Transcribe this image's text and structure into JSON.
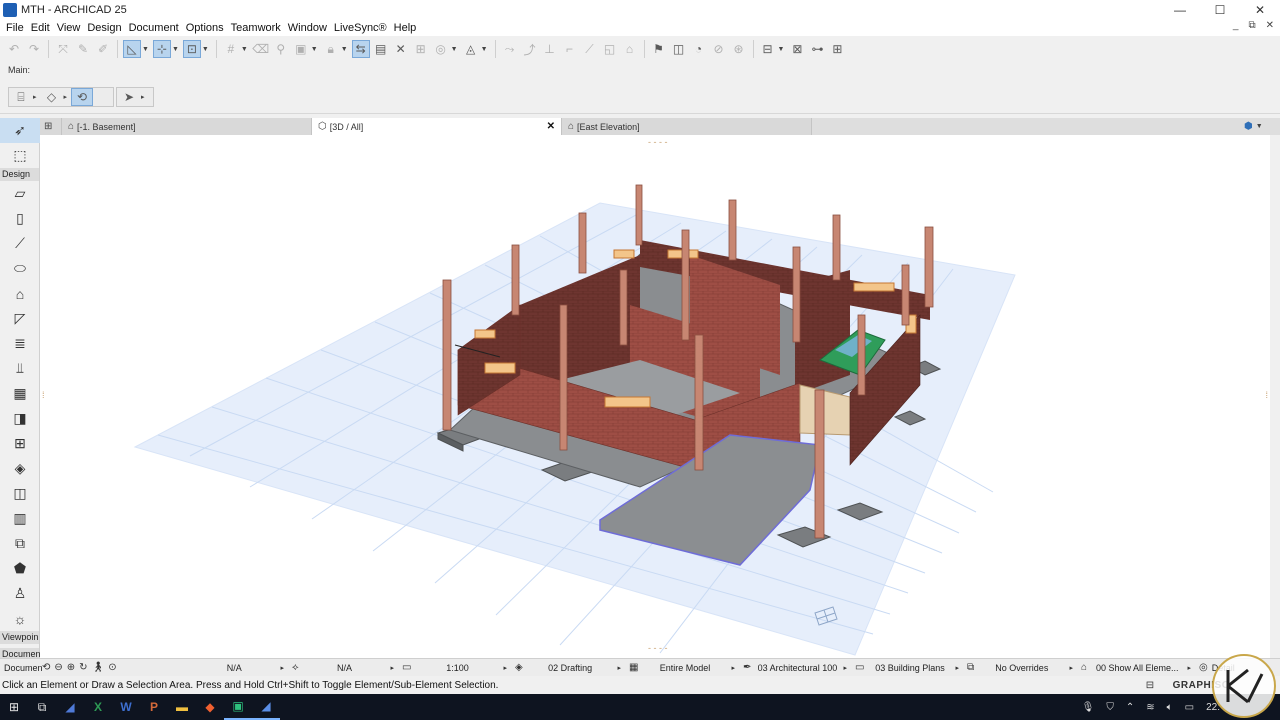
{
  "window": {
    "title": "MTH - ARCHICAD 25",
    "minimize": "—",
    "maximize": "☐",
    "close": "✕"
  },
  "menu": [
    "File",
    "Edit",
    "View",
    "Design",
    "Document",
    "Options",
    "Teamwork",
    "Window",
    "LiveSync®",
    "Help"
  ],
  "toolbar2": {
    "label": "Main:"
  },
  "toolbox": {
    "design_label": "Design",
    "viewpoint_label": "Viewpoin",
    "document_label": "Documen"
  },
  "tabs": [
    {
      "label": "[-1. Basement]",
      "icon": "floorplan-icon"
    },
    {
      "label": "[3D / All]",
      "icon": "3d-icon",
      "close": "✕"
    },
    {
      "label": "[East Elevation]",
      "icon": "elevation-icon"
    }
  ],
  "bottombar": {
    "zoom_a": "N/A",
    "zoom_b": "N/A",
    "scale": "1:100",
    "layer_combo": "02 Drafting",
    "model_view": "Entire Model",
    "pen_set": "03 Architectural 100",
    "mvo": "03 Building Plans",
    "overrides": "No Overrides",
    "renovation": "00 Show All Eleme...",
    "detail": "Detail"
  },
  "status": {
    "hint": "Click an Element or Draw a Selection Area. Press and Hold Ctrl+Shift to Toggle Element/Sub-Element Selection.",
    "brand": "GRAPHISO"
  },
  "taskbar": {
    "time": "22:"
  },
  "colors": {
    "brick": "#9e4e45",
    "grid": "#c9daf3",
    "concrete": "#7a7d80",
    "garage_door": "#e6d2b2",
    "accent": "#1e5fb4"
  }
}
